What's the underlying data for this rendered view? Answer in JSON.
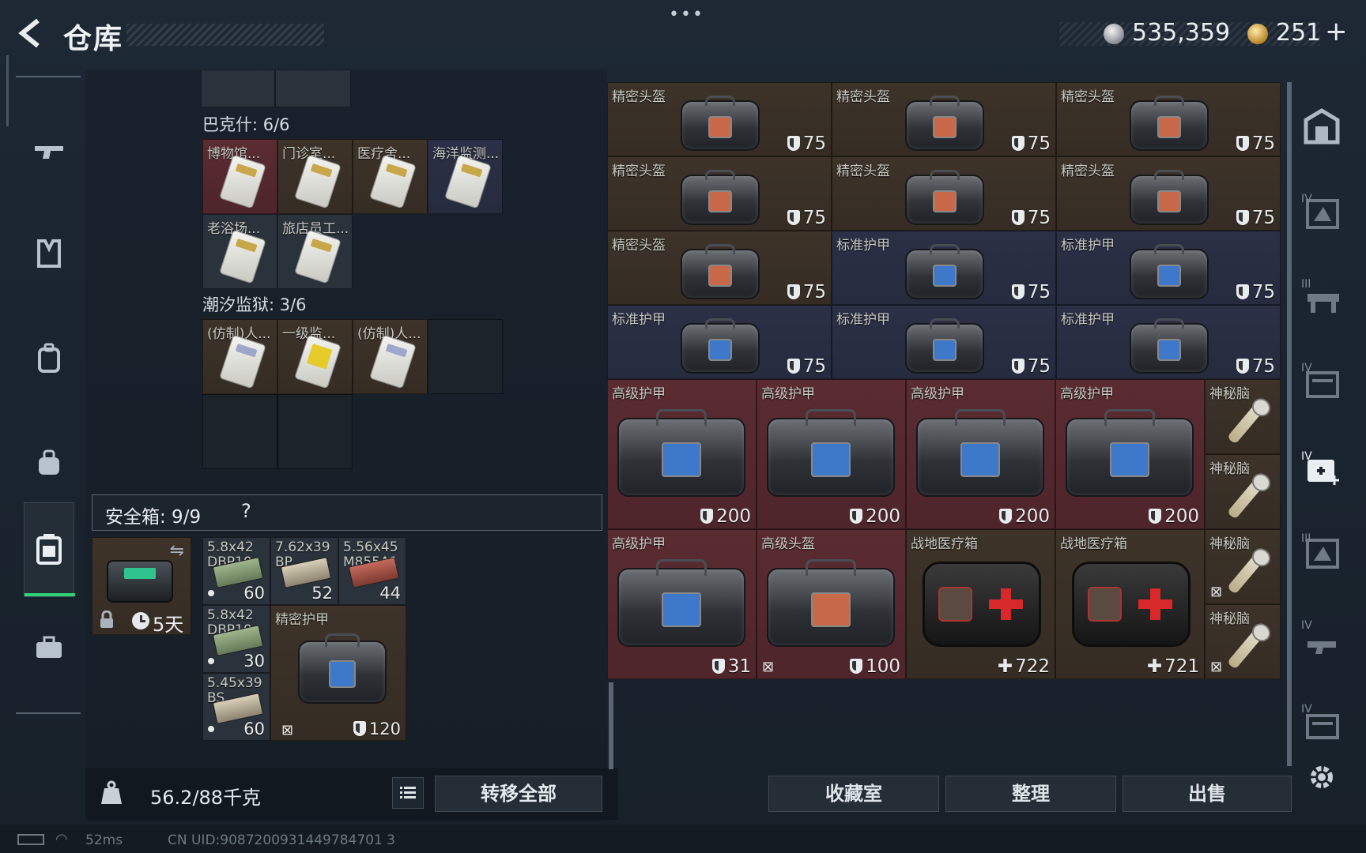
{
  "header": {
    "back_icon": "back-arrow-icon",
    "title": "仓库",
    "more_icon": "more-dots-icon",
    "silver_amount": "535,359",
    "gold_amount": "251",
    "gold_add": "+"
  },
  "sidebar": {
    "items": [
      {
        "name": "weapon-tab",
        "icon": "rifle-icon"
      },
      {
        "name": "vest-tab",
        "icon": "vest-icon"
      },
      {
        "name": "backpack-tab",
        "icon": "backpack-icon"
      },
      {
        "name": "bag-tab",
        "icon": "bag-icon"
      },
      {
        "name": "container-tab",
        "icon": "container-icon",
        "active": true
      },
      {
        "name": "case-tab",
        "icon": "briefcase-icon"
      }
    ]
  },
  "collections": {
    "bakshi_label": "巴克什: 6/6",
    "bakshi_items": [
      "博物馆...",
      "门诊室...",
      "医疗舍...",
      "海洋监测...",
      "老浴场...",
      "旅店员工..."
    ],
    "tide_label": "潮汐监狱: 3/6",
    "tide_items": [
      "(仿制)人...",
      "一级监...",
      "(仿制)人..."
    ]
  },
  "safe_box": {
    "title": "安全箱: 9/9",
    "help": "?",
    "timer": "5天",
    "items": [
      {
        "label": "5.8x42 DBP10",
        "count": "60"
      },
      {
        "label": "7.62x39 BP",
        "count": "52"
      },
      {
        "label": "5.56x45 M855A1",
        "count": "44"
      },
      {
        "label": "5.8x42 DBP10",
        "count": "30"
      },
      {
        "label": "精密护甲",
        "durability": "120"
      },
      {
        "label": "5.45x39 BS",
        "count": "60"
      }
    ]
  },
  "footer_left": {
    "weight": "56.2/88千克",
    "transfer_all": "转移全部"
  },
  "stash": {
    "grid_small": [
      {
        "label": "精密头盔",
        "value": "75",
        "tone": "brown"
      },
      {
        "label": "精密头盔",
        "value": "75",
        "tone": "brown"
      },
      {
        "label": "精密头盔",
        "value": "75",
        "tone": "brown"
      },
      {
        "label": "精密头盔",
        "value": "75",
        "tone": "brown"
      },
      {
        "label": "精密头盔",
        "value": "75",
        "tone": "brown"
      },
      {
        "label": "精密头盔",
        "value": "75",
        "tone": "brown"
      },
      {
        "label": "精密头盔",
        "value": "75",
        "tone": "brown"
      },
      {
        "label": "标准护甲",
        "value": "75",
        "tone": "blue"
      },
      {
        "label": "标准护甲",
        "value": "75",
        "tone": "blue"
      },
      {
        "label": "标准护甲",
        "value": "75",
        "tone": "blue"
      },
      {
        "label": "标准护甲",
        "value": "75",
        "tone": "blue"
      },
      {
        "label": "标准护甲",
        "value": "75",
        "tone": "blue"
      }
    ],
    "grid_big_row1": [
      {
        "label": "高级护甲",
        "value": "200"
      },
      {
        "label": "高级护甲",
        "value": "200"
      },
      {
        "label": "高级护甲",
        "value": "200"
      },
      {
        "label": "高级护甲",
        "value": "200"
      }
    ],
    "grid_big_row2": [
      {
        "label": "高级护甲",
        "value": "31"
      },
      {
        "label": "高级头盔",
        "value": "100"
      },
      {
        "label": "战地医疗箱",
        "value": "722"
      },
      {
        "label": "战地医疗箱",
        "value": "721"
      }
    ],
    "implants": [
      "神秘脑",
      "神秘脑",
      "神秘脑",
      "神秘脑"
    ]
  },
  "footer_right": {
    "collection_room": "收藏室",
    "organize": "整理",
    "sell": "出售"
  },
  "status_bar": {
    "ping": "52ms",
    "uid": "CN UID:9087200931449784701 3"
  },
  "colors": {
    "red_cell": "#5a2c32",
    "brown_cell": "#3d3329",
    "blue_cell": "#2b3046",
    "accent_green": "#2fd07a"
  }
}
